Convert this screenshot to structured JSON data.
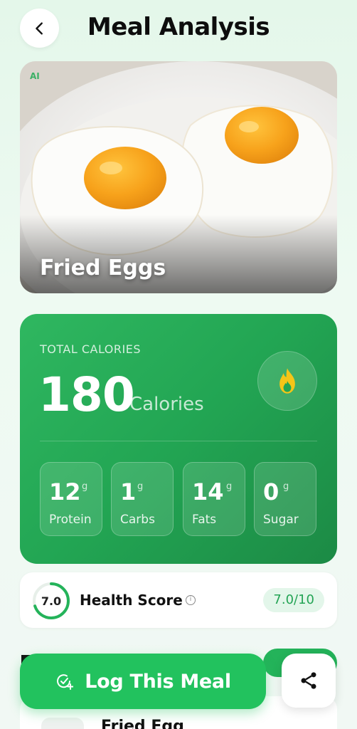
{
  "header": {
    "title": "Meal Analysis",
    "back_icon": "chevron-left-icon"
  },
  "meal": {
    "name": "Fried Eggs",
    "badge": "AI"
  },
  "calories": {
    "label": "TOTAL CALORIES",
    "value": "180",
    "unit": "Calories",
    "icon": "flame-icon",
    "icon_color": "#f5c518",
    "macros": [
      {
        "value": "12",
        "unit": "g",
        "name": "Protein"
      },
      {
        "value": "1",
        "unit": "g",
        "name": "Carbs"
      },
      {
        "value": "14",
        "unit": "g",
        "name": "Fats"
      },
      {
        "value": "0",
        "unit": "g",
        "name": "Sugar"
      }
    ]
  },
  "health": {
    "score": "7.0",
    "title": "Health Score",
    "info_icon": "info-icon",
    "pill": "7.0/10",
    "fraction": 0.7,
    "color": "#24b35a"
  },
  "list": {
    "item_name": "Fried Egg"
  },
  "actions": {
    "log_label": "Log This Meal",
    "log_icon": "add-check-icon",
    "share_icon": "share-icon",
    "accent": "#22c25e"
  }
}
